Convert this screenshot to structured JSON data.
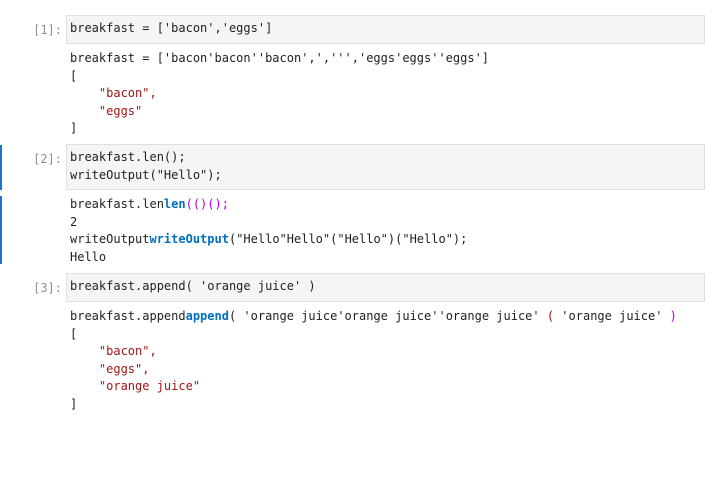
{
  "cells": [
    {
      "prompt": "[1]:",
      "input": [
        "breakfast = ['bacon','eggs']"
      ],
      "output": {
        "echo": [
          "breakfast = ['bacon'bacon''bacon',',''','eggs'eggs''eggs']"
        ],
        "lines": [
          "[",
          "    \"bacon\",",
          "    \"eggs\"",
          "]"
        ]
      }
    },
    {
      "prompt": "[2]:",
      "input": [
        "breakfast.len();",
        "writeOutput(\"Hello\");"
      ],
      "output": {
        "line1_a": "breakfast.len",
        "line1_b": "len",
        "line1_c": "(()();",
        "result1": "2",
        "line3_a": "writeOutput",
        "line3_b": "writeOutput",
        "line3_c": "(\"Hello\"Hello\"(\"Hello\")(\"Hello\");",
        "result2": "Hello"
      }
    },
    {
      "prompt": "[3]:",
      "input": [
        "breakfast.append( 'orange juice' )"
      ],
      "output": {
        "echo_a": "breakfast.append",
        "echo_b": "append",
        "echo_c": "( 'orange juice'orange juice''orange juice' ",
        "echo_d": "(",
        "echo_e": " 'orange juice' ",
        "echo_f": ")",
        "lines": [
          "[",
          "    \"bacon\",",
          "    \"eggs\",",
          "    \"orange juice\"",
          "]"
        ]
      }
    }
  ]
}
